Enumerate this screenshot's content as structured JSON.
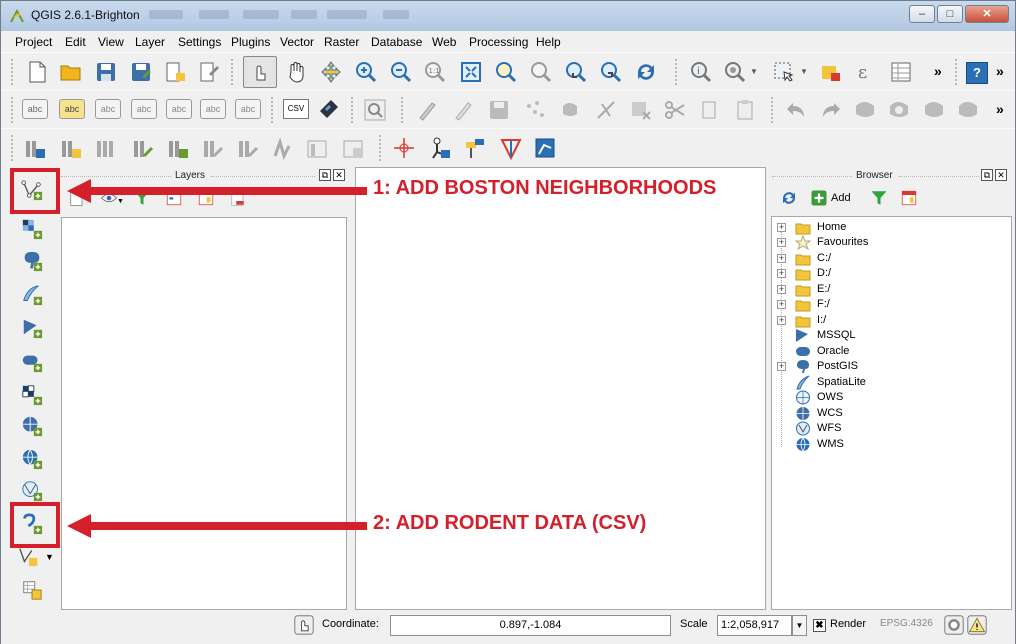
{
  "window": {
    "title": "QGIS 2.6.1-Brighton",
    "minimize": "–",
    "maximize": "□",
    "close": "✕"
  },
  "menu": [
    "Project",
    "Edit",
    "View",
    "Layer",
    "Settings",
    "Plugins",
    "Vector",
    "Raster",
    "Database",
    "Web",
    "Processing",
    "Help"
  ],
  "toolbar": {
    "more": "»",
    "csv_label": "CSV",
    "abc": "abc",
    "help": "?"
  },
  "layers_panel": {
    "title": "Layers"
  },
  "browser_panel": {
    "title": "Browser",
    "add_label": "Add",
    "items": [
      "Home",
      "Favourites",
      "C:/",
      "D:/",
      "E:/",
      "F:/",
      "I:/",
      "MSSQL",
      "Oracle",
      "PostGIS",
      "SpatiaLite",
      "OWS",
      "WCS",
      "WFS",
      "WMS"
    ]
  },
  "annotations": {
    "step1": "1: ADD BOSTON NEIGHBORHOODS",
    "step2": "2: ADD RODENT DATA (CSV)",
    "color": "#d3202a"
  },
  "status": {
    "coordinate_label": "Coordinate:",
    "coordinate_value": "0.897,-1.084",
    "scale_label": "Scale",
    "scale_value": "1:2,058,917",
    "render_label": "Render",
    "epsg": "EPSG:4326"
  },
  "colors": {
    "accent": "#2a6fb5",
    "titlebar": "#c9daed",
    "annotation": "#d3202a"
  }
}
